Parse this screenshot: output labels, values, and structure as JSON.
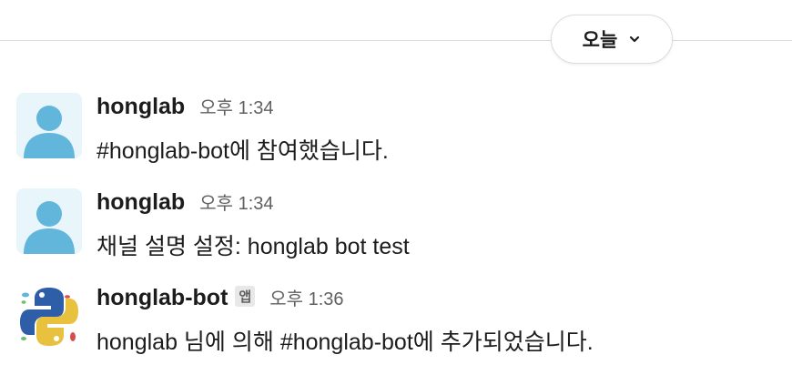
{
  "date_divider": {
    "label": "오늘",
    "icon": "chevron-down-icon"
  },
  "messages": [
    {
      "sender": "honglab",
      "time": "오후 1:34",
      "text": "#honglab-bot에 참여했습니다.",
      "avatar": "default-person-avatar"
    },
    {
      "sender": "honglab",
      "time": "오후 1:34",
      "text": "채널 설명 설정: honglab bot test",
      "avatar": "default-person-avatar"
    },
    {
      "sender": "honglab-bot",
      "badge": "앱",
      "time": "오후 1:36",
      "text": "honglab 님에 의해 #honglab-bot에 추가되었습니다.",
      "avatar": "python-logo-avatar"
    }
  ],
  "colors": {
    "avatar_person": "#62b5db",
    "avatar_bg": "#e8f5fa",
    "python_blue": "#2f5ea8",
    "python_yellow": "#e8c13e"
  }
}
